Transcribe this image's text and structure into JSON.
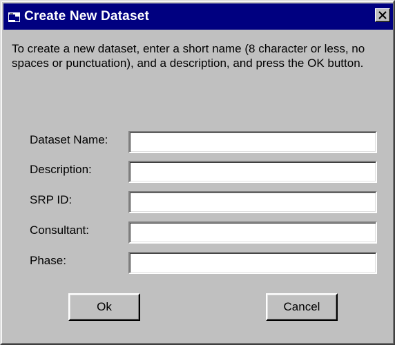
{
  "window": {
    "title": "Create New Dataset",
    "icon": "folder-dataset-icon",
    "close_glyph": "close-icon",
    "titlebar_color": "#000080",
    "background_color": "#c0c0c0"
  },
  "instructions": "To create a new dataset, enter a short name (8 character or less, no spaces or punctuation), and a description, and press the OK button.",
  "form": {
    "fields": [
      {
        "label": "Dataset Name:",
        "value": ""
      },
      {
        "label": "Description:",
        "value": ""
      },
      {
        "label": "SRP ID:",
        "value": ""
      },
      {
        "label": "Consultant:",
        "value": ""
      },
      {
        "label": "Phase:",
        "value": ""
      }
    ]
  },
  "buttons": {
    "ok_label": "Ok",
    "cancel_label": "Cancel"
  }
}
